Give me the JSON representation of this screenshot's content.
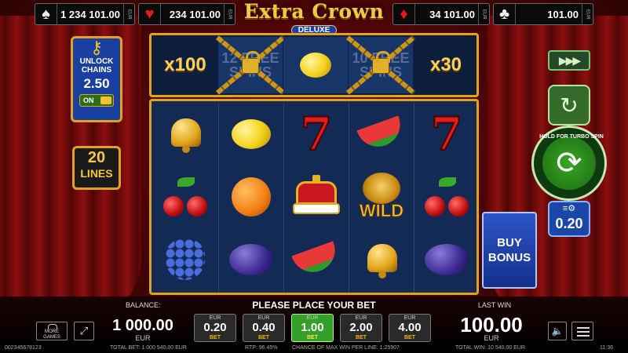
{
  "jackpots": [
    {
      "suit": "♠",
      "amount": "1 234 101.00",
      "currency": "EUR"
    },
    {
      "suit": "♥",
      "amount": "234 101.00",
      "currency": "EUR"
    },
    {
      "suit": "♦",
      "amount": "34 101.00",
      "currency": "EUR"
    },
    {
      "suit": "♣",
      "amount": "101.00",
      "currency": "EUR"
    }
  ],
  "logo": {
    "title": "Extra Crown",
    "subtitle": "DELUXE"
  },
  "top_row": [
    {
      "multiplier": "x100"
    },
    {
      "locked_text": "12 FREE SPINS",
      "locked": true
    },
    {
      "symbol": "lemon"
    },
    {
      "locked_text": "10 FREE SPINS",
      "locked": true
    },
    {
      "multiplier": "x30"
    }
  ],
  "reels": [
    [
      "bell",
      "cherries",
      "grapes"
    ],
    [
      "lemon",
      "orange",
      "plum"
    ],
    [
      "seven",
      "crown",
      "watermelon"
    ],
    [
      "watermelon",
      "lion-wild",
      "bell"
    ],
    [
      "seven",
      "cherries",
      "plum"
    ]
  ],
  "wild_label": "WILD",
  "seven_label": "7",
  "left_panel": {
    "unlock_label_1": "UNLOCK",
    "unlock_label_2": "CHAINS",
    "unlock_value": "2.50",
    "toggle_label": "ON",
    "lines_value": "20",
    "lines_label": "LINES"
  },
  "right_panel": {
    "turbo_label": "HOLD FOR TURBO SPIN",
    "bet_value": "0.20",
    "buy_bonus_1": "BUY",
    "buy_bonus_2": "BONUS"
  },
  "bottom": {
    "balance_label": "BALANCE:",
    "balance_value": "1 000.00",
    "balance_currency": "EUR",
    "place_bet_text": "PLEASE PLACE YOUR BET",
    "bets": [
      {
        "currency": "EUR",
        "value": "0.20",
        "label": "BET",
        "active": false
      },
      {
        "currency": "EUR",
        "value": "0.40",
        "label": "BET",
        "active": false
      },
      {
        "currency": "EUR",
        "value": "1.00",
        "label": "BET",
        "active": true
      },
      {
        "currency": "EUR",
        "value": "2.00",
        "label": "BET",
        "active": false
      },
      {
        "currency": "EUR",
        "value": "4.00",
        "label": "BET",
        "active": false
      }
    ],
    "last_win_label": "LAST WIN",
    "last_win_value": "100.00",
    "last_win_currency": "EUR",
    "more_games_1": "MORE",
    "more_games_2": "GAMES"
  },
  "footer": {
    "id": "002345678123",
    "total_bet": "TOTAL BET: 1 000 540.00 EUR",
    "rtp": "RTP: 96.45%",
    "chance": "CHANCE OF MAX WIN PER LINE: 1:25907",
    "total_win": "TOTAL WIN: 10 540.00 EUR",
    "time": "11:36"
  },
  "colors": {
    "gold": "#e0a321",
    "active_bet": "#34a02a",
    "jackpot_red": "#e31b1b"
  }
}
